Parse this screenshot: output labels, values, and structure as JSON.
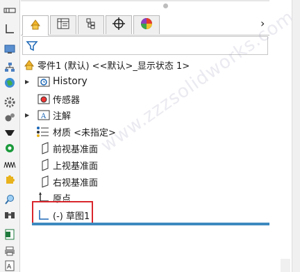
{
  "tabs": [
    {
      "name": "featuremanager",
      "icon": "featuremanager-icon"
    },
    {
      "name": "propertymanager",
      "icon": "propertymanager-icon"
    },
    {
      "name": "configurationmanager",
      "icon": "configurationmanager-icon"
    },
    {
      "name": "dimxpertmanager",
      "icon": "dimxpertmanager-icon"
    },
    {
      "name": "displaymanager",
      "icon": "displaymanager-icon"
    }
  ],
  "tab_scroll": "›",
  "tree": {
    "root_label": "零件1 (默认) <<默认>_显示状态 1>",
    "items": [
      {
        "label": "History",
        "icon": "history-folder-icon",
        "expandable": true
      },
      {
        "label": "传感器",
        "icon": "sensors-icon",
        "expandable": false
      },
      {
        "label": "注解",
        "icon": "annotations-icon",
        "expandable": true
      },
      {
        "label": "材质 <未指定>",
        "icon": "material-icon",
        "expandable": false
      },
      {
        "label": "前视基准面",
        "icon": "plane-icon",
        "expandable": false
      },
      {
        "label": "上视基准面",
        "icon": "plane-icon",
        "expandable": false
      },
      {
        "label": "右视基准面",
        "icon": "plane-icon",
        "expandable": false
      },
      {
        "label": "原点",
        "icon": "origin-icon",
        "expandable": false
      },
      {
        "label": "(-) 草图1",
        "icon": "sketch-icon",
        "expandable": false
      }
    ],
    "expander_glyph": "▶"
  },
  "watermark": "www.zzzsolidworks.com",
  "colors": {
    "selection_border": "#d9262b",
    "rollback_bar": "#3d8ac0"
  }
}
